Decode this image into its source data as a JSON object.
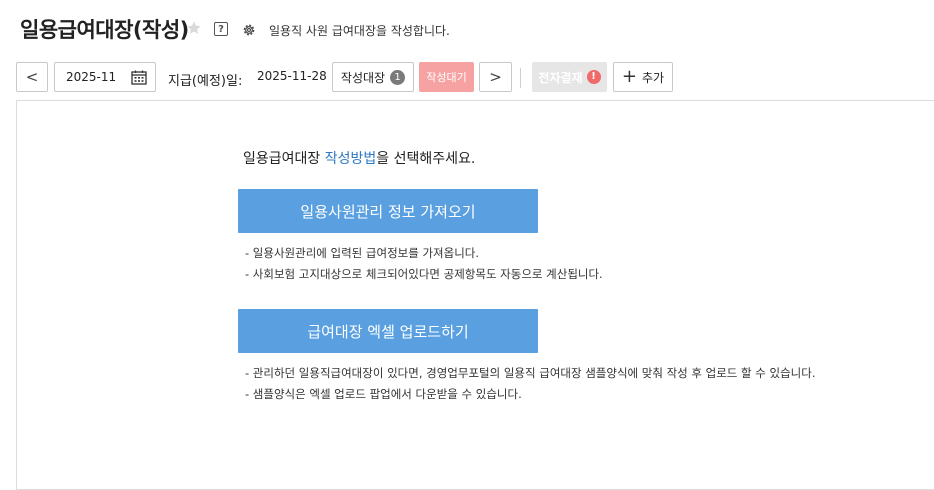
{
  "header": {
    "title": "일용급여대장(작성)",
    "help_glyph": "?",
    "description": "일용직 사원 급여대장을 작성합니다."
  },
  "toolbar": {
    "prev_glyph": "<",
    "month": "2025-11",
    "pay_label": "지급(예정)일:",
    "pay_date": "2025-11-28",
    "draft_label": "작성대장",
    "draft_count": "1",
    "wait_label": "작성대기",
    "next_glyph": ">",
    "esign_label": "전자결재",
    "esign_warn": "!",
    "add_plus": "+",
    "add_label": "추가"
  },
  "main": {
    "prompt_before": "일용급여대장 ",
    "prompt_accent": "작성방법",
    "prompt_after": "을 선택해주세요.",
    "import_button": "일용사원관리 정보 가져오기",
    "import_notes": [
      "- 일용사원관리에 입력된 급여정보를 가져옵니다.",
      "- 사회보험 고지대상으로 체크되어있다면 공제항목도 자동으로 계산됩니다."
    ],
    "upload_button": "급여대장 엑셀 업로드하기",
    "upload_notes": [
      "- 관리하던 일용직급여대장이 있다면, 경영업무포털의 일용직 급여대장 샘플양식에 맞춰 작성 후 업로드 할 수 있습니다.",
      "- 샘플양식은 엑셀 업로드 팝업에서 다운받을 수 있습니다."
    ]
  },
  "colors": {
    "accent": "#2f78c4",
    "primary_button": "#5aa0e0",
    "wait_button": "#f7a2a2",
    "warn": "#f06a6a"
  }
}
